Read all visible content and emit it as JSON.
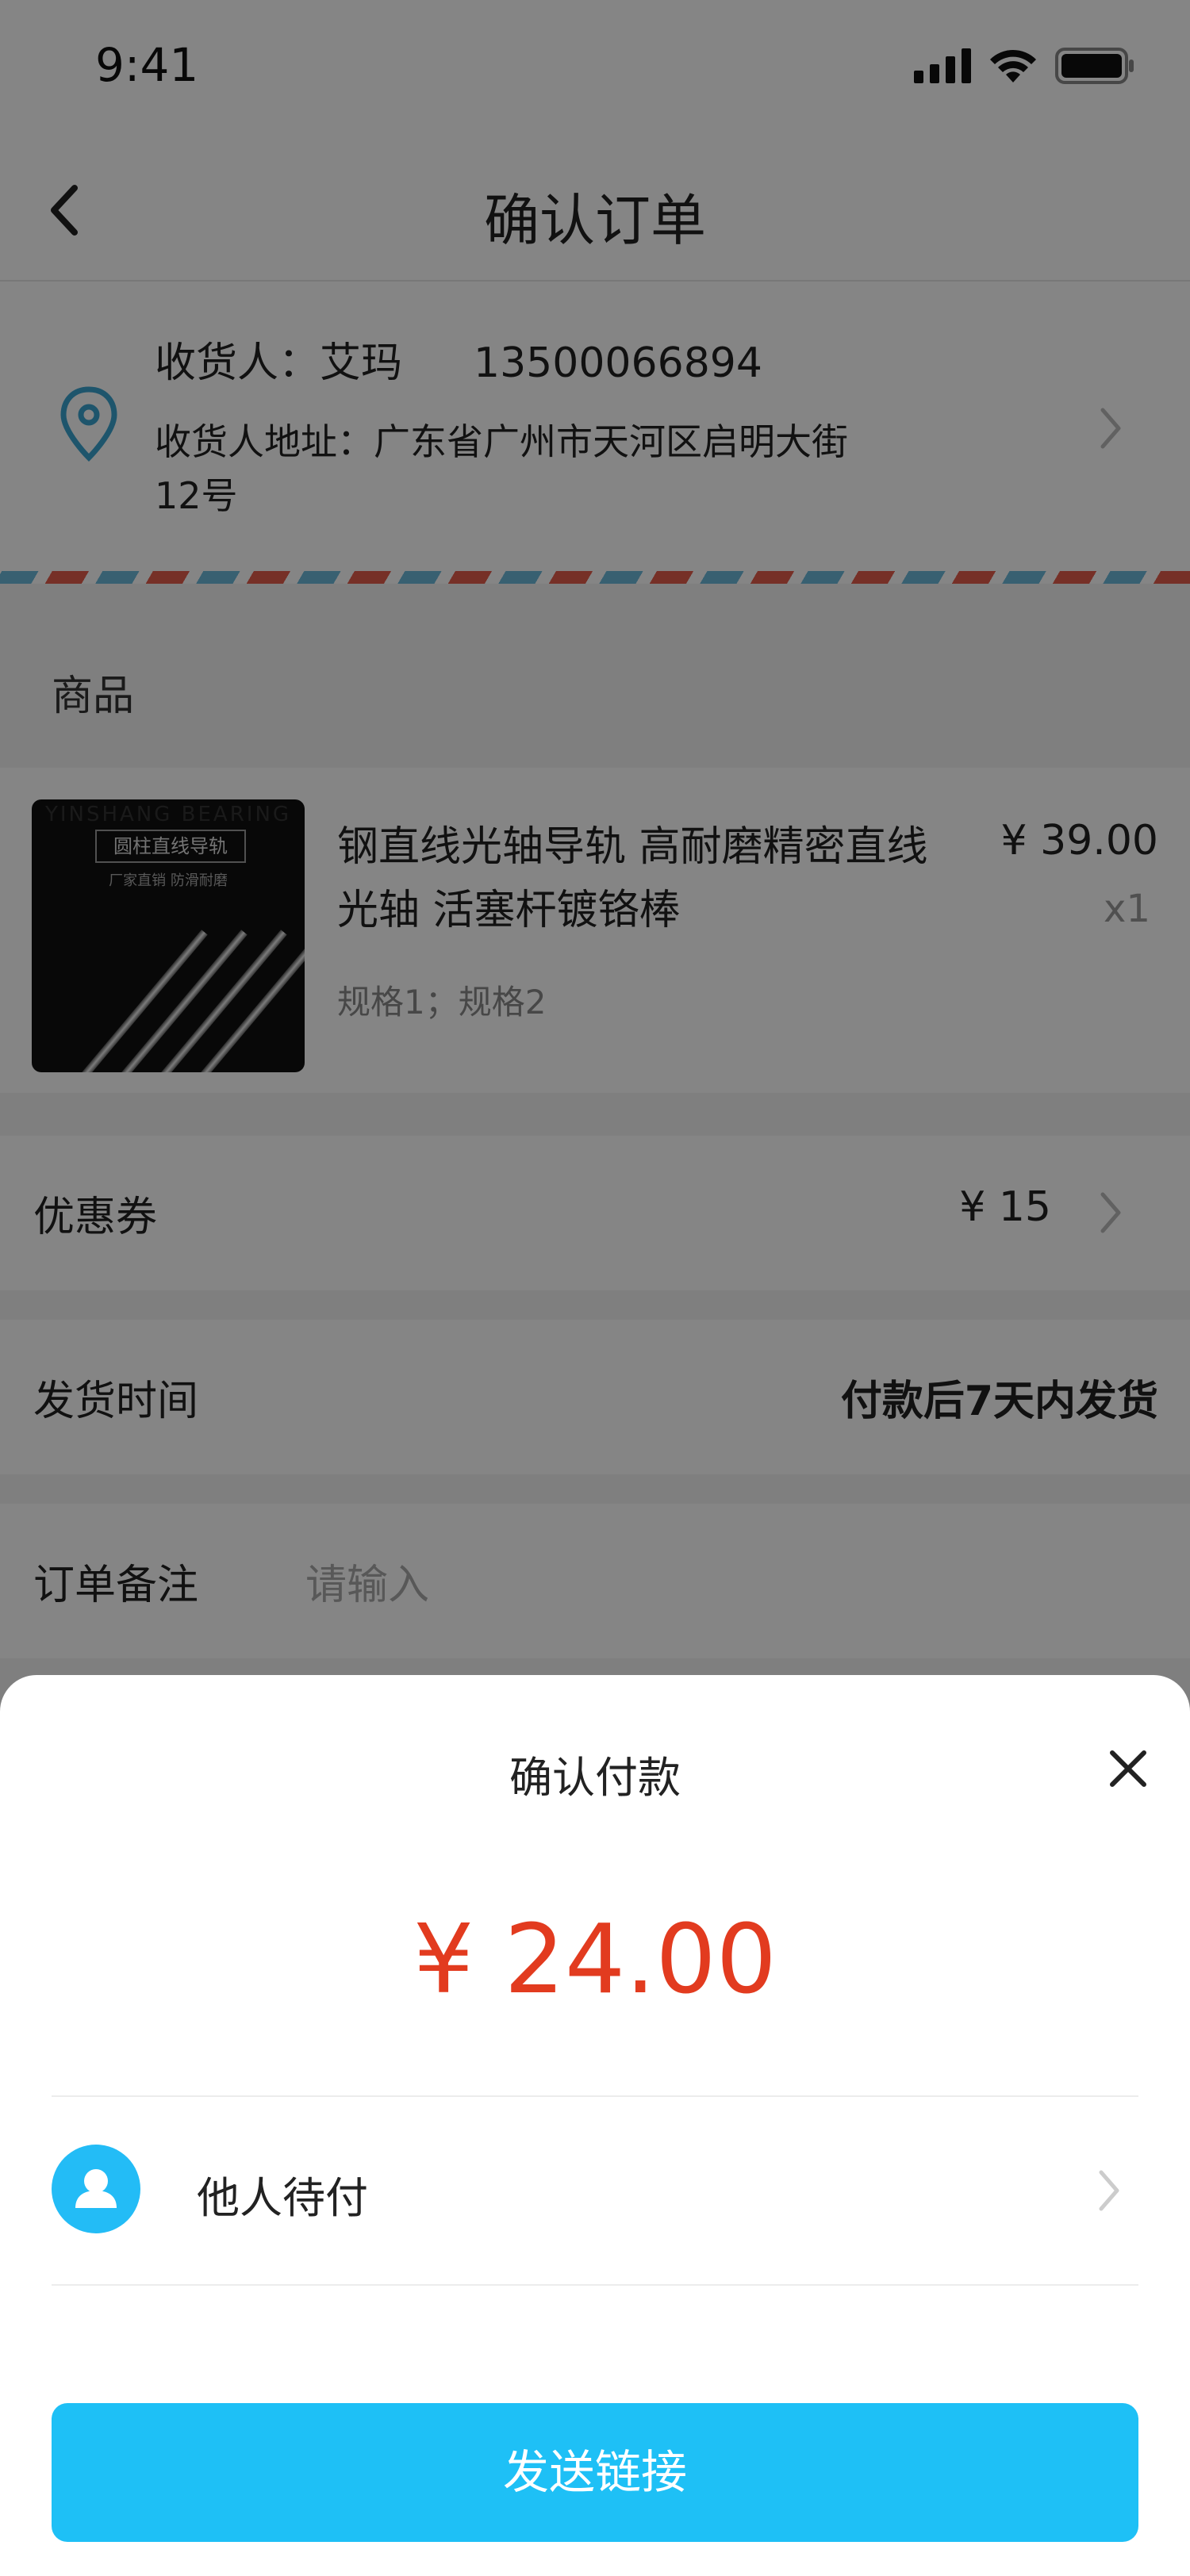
{
  "status_bar": {
    "time": "9:41"
  },
  "nav": {
    "title": "确认订单"
  },
  "address": {
    "receiver_label": "收货人：艾玛",
    "phone": "13500066894",
    "address_text": "收货人地址：广东省广州市天河区启明大街12号"
  },
  "goods_section": {
    "label": "商品"
  },
  "product": {
    "thumb_brand": "YINSHANG BEARING",
    "thumb_title": "圆柱直线导轨",
    "thumb_sub": "厂家直销  防滑耐磨",
    "name": "钢直线光轴导轨 高耐磨精密直线光轴 活塞杆镀铬棒",
    "spec": "规格1；规格2",
    "price": "¥ 39.00",
    "quantity": "x1"
  },
  "coupon": {
    "label": "优惠券",
    "value": "¥ 15"
  },
  "delivery": {
    "label": "发货时间",
    "value": "付款后7天内发货"
  },
  "remark": {
    "label": "订单备注",
    "placeholder": "请输入"
  },
  "payment_sheet": {
    "title": "确认付款",
    "amount": "¥ 24.00",
    "payer_option": "他人待付",
    "send_button": "发送链接"
  },
  "colors": {
    "accent": "#1EC0F6",
    "price_red": "#E23B1F",
    "overlay": "#000000"
  },
  "icons": [
    "signal-icon",
    "wifi-icon",
    "battery-icon",
    "back-chevron-icon",
    "location-pin-icon",
    "chevron-right-icon",
    "close-icon",
    "user-avatar-icon"
  ]
}
